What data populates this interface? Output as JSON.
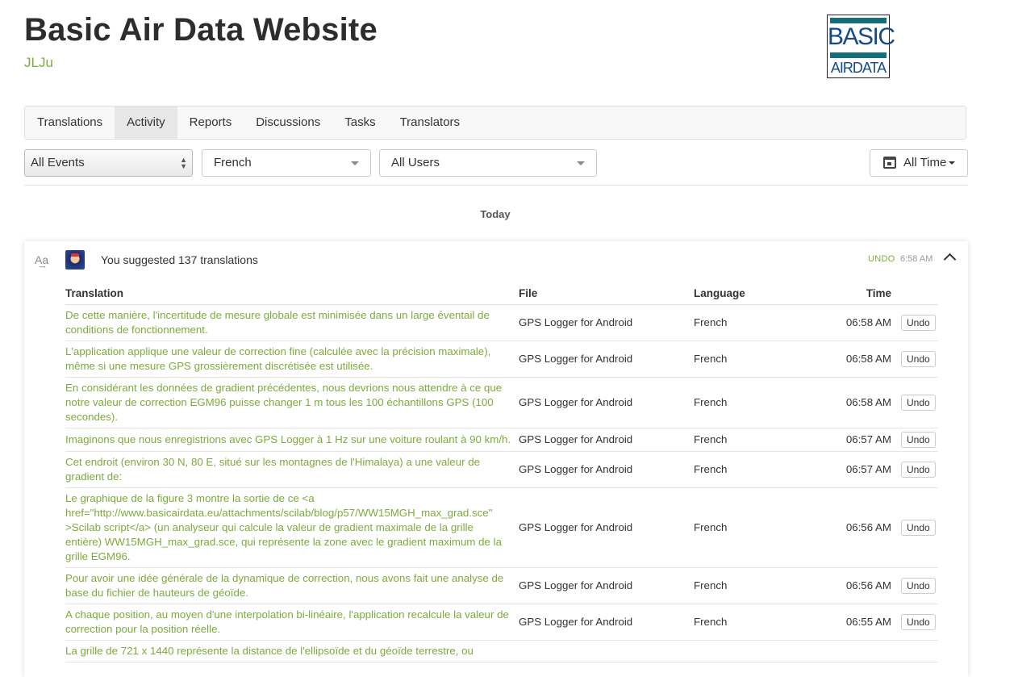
{
  "project": {
    "title": "Basic Air Data Website",
    "owner": "JLJu"
  },
  "logo": {
    "line1": "BASIC",
    "line2": "AIRDATA"
  },
  "nav": {
    "tabs": [
      {
        "label": "Translations"
      },
      {
        "label": "Activity",
        "active": true
      },
      {
        "label": "Reports"
      },
      {
        "label": "Discussions"
      },
      {
        "label": "Tasks"
      },
      {
        "label": "Translators"
      }
    ]
  },
  "filters": {
    "events": "All Events",
    "language": "French",
    "users": "All Users",
    "time": "All Time"
  },
  "group": {
    "label": "Today"
  },
  "activity": {
    "summary": "You suggested 137 translations",
    "undo_label": "UNDO",
    "time": "6:58 AM",
    "columns": {
      "translation": "Translation",
      "file": "File",
      "language": "Language",
      "time": "Time"
    },
    "undo_button_label": "Undo",
    "rows": [
      {
        "translation": "De cette manière, l'incertitude de mesure globale est minimisée dans un large éventail de conditions de fonctionnement.",
        "file": "GPS Logger for Android",
        "language": "French",
        "time": "06:58 AM"
      },
      {
        "translation": "L'application applique une valeur de correction fine (calculée avec la précision maximale), même si une mesure GPS grossièrement discrétisée est utilisée.",
        "file": "GPS Logger for Android",
        "language": "French",
        "time": "06:58 AM"
      },
      {
        "translation": "En considérant les données de gradient précédentes, nous devrions nous attendre à ce que notre valeur de correction EGM96 puisse changer 1 m tous les 100 échantillons GPS (100 secondes).",
        "file": "GPS Logger for Android",
        "language": "French",
        "time": "06:58 AM"
      },
      {
        "translation": "Imaginons que nous enregistrions avec GPS Logger à 1 Hz sur une voiture roulant à 90 km/h.",
        "file": "GPS Logger for Android",
        "language": "French",
        "time": "06:57 AM"
      },
      {
        "translation": "Cet endroit (environ 30 N, 80 E, situé sur les montagnes de l'Himalaya) a une valeur de gradient de:",
        "file": "GPS Logger for Android",
        "language": "French",
        "time": "06:57 AM"
      },
      {
        "translation": "Le graphique de la figure 3 montre la sortie de ce <a href=\"http://www.basicairdata.eu/attachments/scilab/blog/p57/WW15MGH_max_grad.sce\" >Scilab script</a> (un analyseur qui calcule la valeur de gradient maximale de la grille entière) WW15MGH_max_grad.sce, qui représente la zone avec le gradient maximum de la grille EGM96.",
        "file": "GPS Logger for Android",
        "language": "French",
        "time": "06:56 AM"
      },
      {
        "translation": "Pour avoir une idée générale de la dynamique de correction, nous avons fait une analyse de base du fichier de hauteurs de géoïde.",
        "file": "GPS Logger for Android",
        "language": "French",
        "time": "06:56 AM"
      },
      {
        "translation": "A chaque position, au moyen d'une interpolation bi-linéaire, l'application recalcule la valeur de correction pour la position réelle.",
        "file": "GPS Logger for Android",
        "language": "French",
        "time": "06:55 AM"
      },
      {
        "translation": "La grille de 721 x 1440 représente la distance de l'ellipsoïde et du géoïde terrestre, ou",
        "file": "",
        "language": "",
        "time": ""
      }
    ]
  }
}
